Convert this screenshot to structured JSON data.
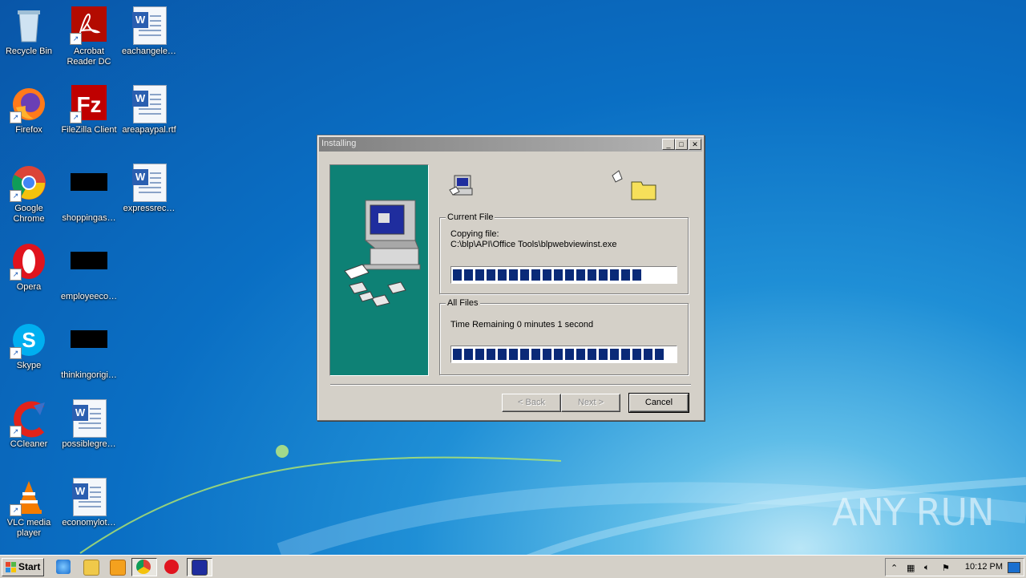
{
  "desktop": {
    "icons": [
      {
        "label": "Recycle Bin"
      },
      {
        "label": "Acrobat Reader DC"
      },
      {
        "label": "eachangele…"
      },
      {
        "label": "Firefox"
      },
      {
        "label": "FileZilla Client"
      },
      {
        "label": "areapaypal.rtf"
      },
      {
        "label": "Google Chrome"
      },
      {
        "label": "shoppingas…"
      },
      {
        "label": "expressrec…"
      },
      {
        "label": "Opera"
      },
      {
        "label": "employeeco…"
      },
      {
        "label": "Skype"
      },
      {
        "label": "thinkingorigi…"
      },
      {
        "label": "CCleaner"
      },
      {
        "label": "possiblegre…"
      },
      {
        "label": "VLC media player"
      },
      {
        "label": "economylot…"
      }
    ]
  },
  "window": {
    "title": "Installing",
    "current_file": {
      "legend": "Current File",
      "status": "Copying file:",
      "path": "C:\\blp\\API\\Office Tools\\blpwebviewinst.exe",
      "progress": 0.9
    },
    "all_files": {
      "legend": "All Files",
      "time_remaining": "Time Remaining 0 minutes 1 second",
      "progress": 0.98
    },
    "buttons": {
      "back": "< Back",
      "next": "Next >",
      "cancel": "Cancel"
    }
  },
  "taskbar": {
    "start_label": "Start",
    "clock": "10:12 PM"
  },
  "watermark": "ANY RUN",
  "colors": {
    "side_panel": "#0e8175",
    "progress_block": "#0a2a78",
    "titlebar_inactive": "#808080"
  }
}
